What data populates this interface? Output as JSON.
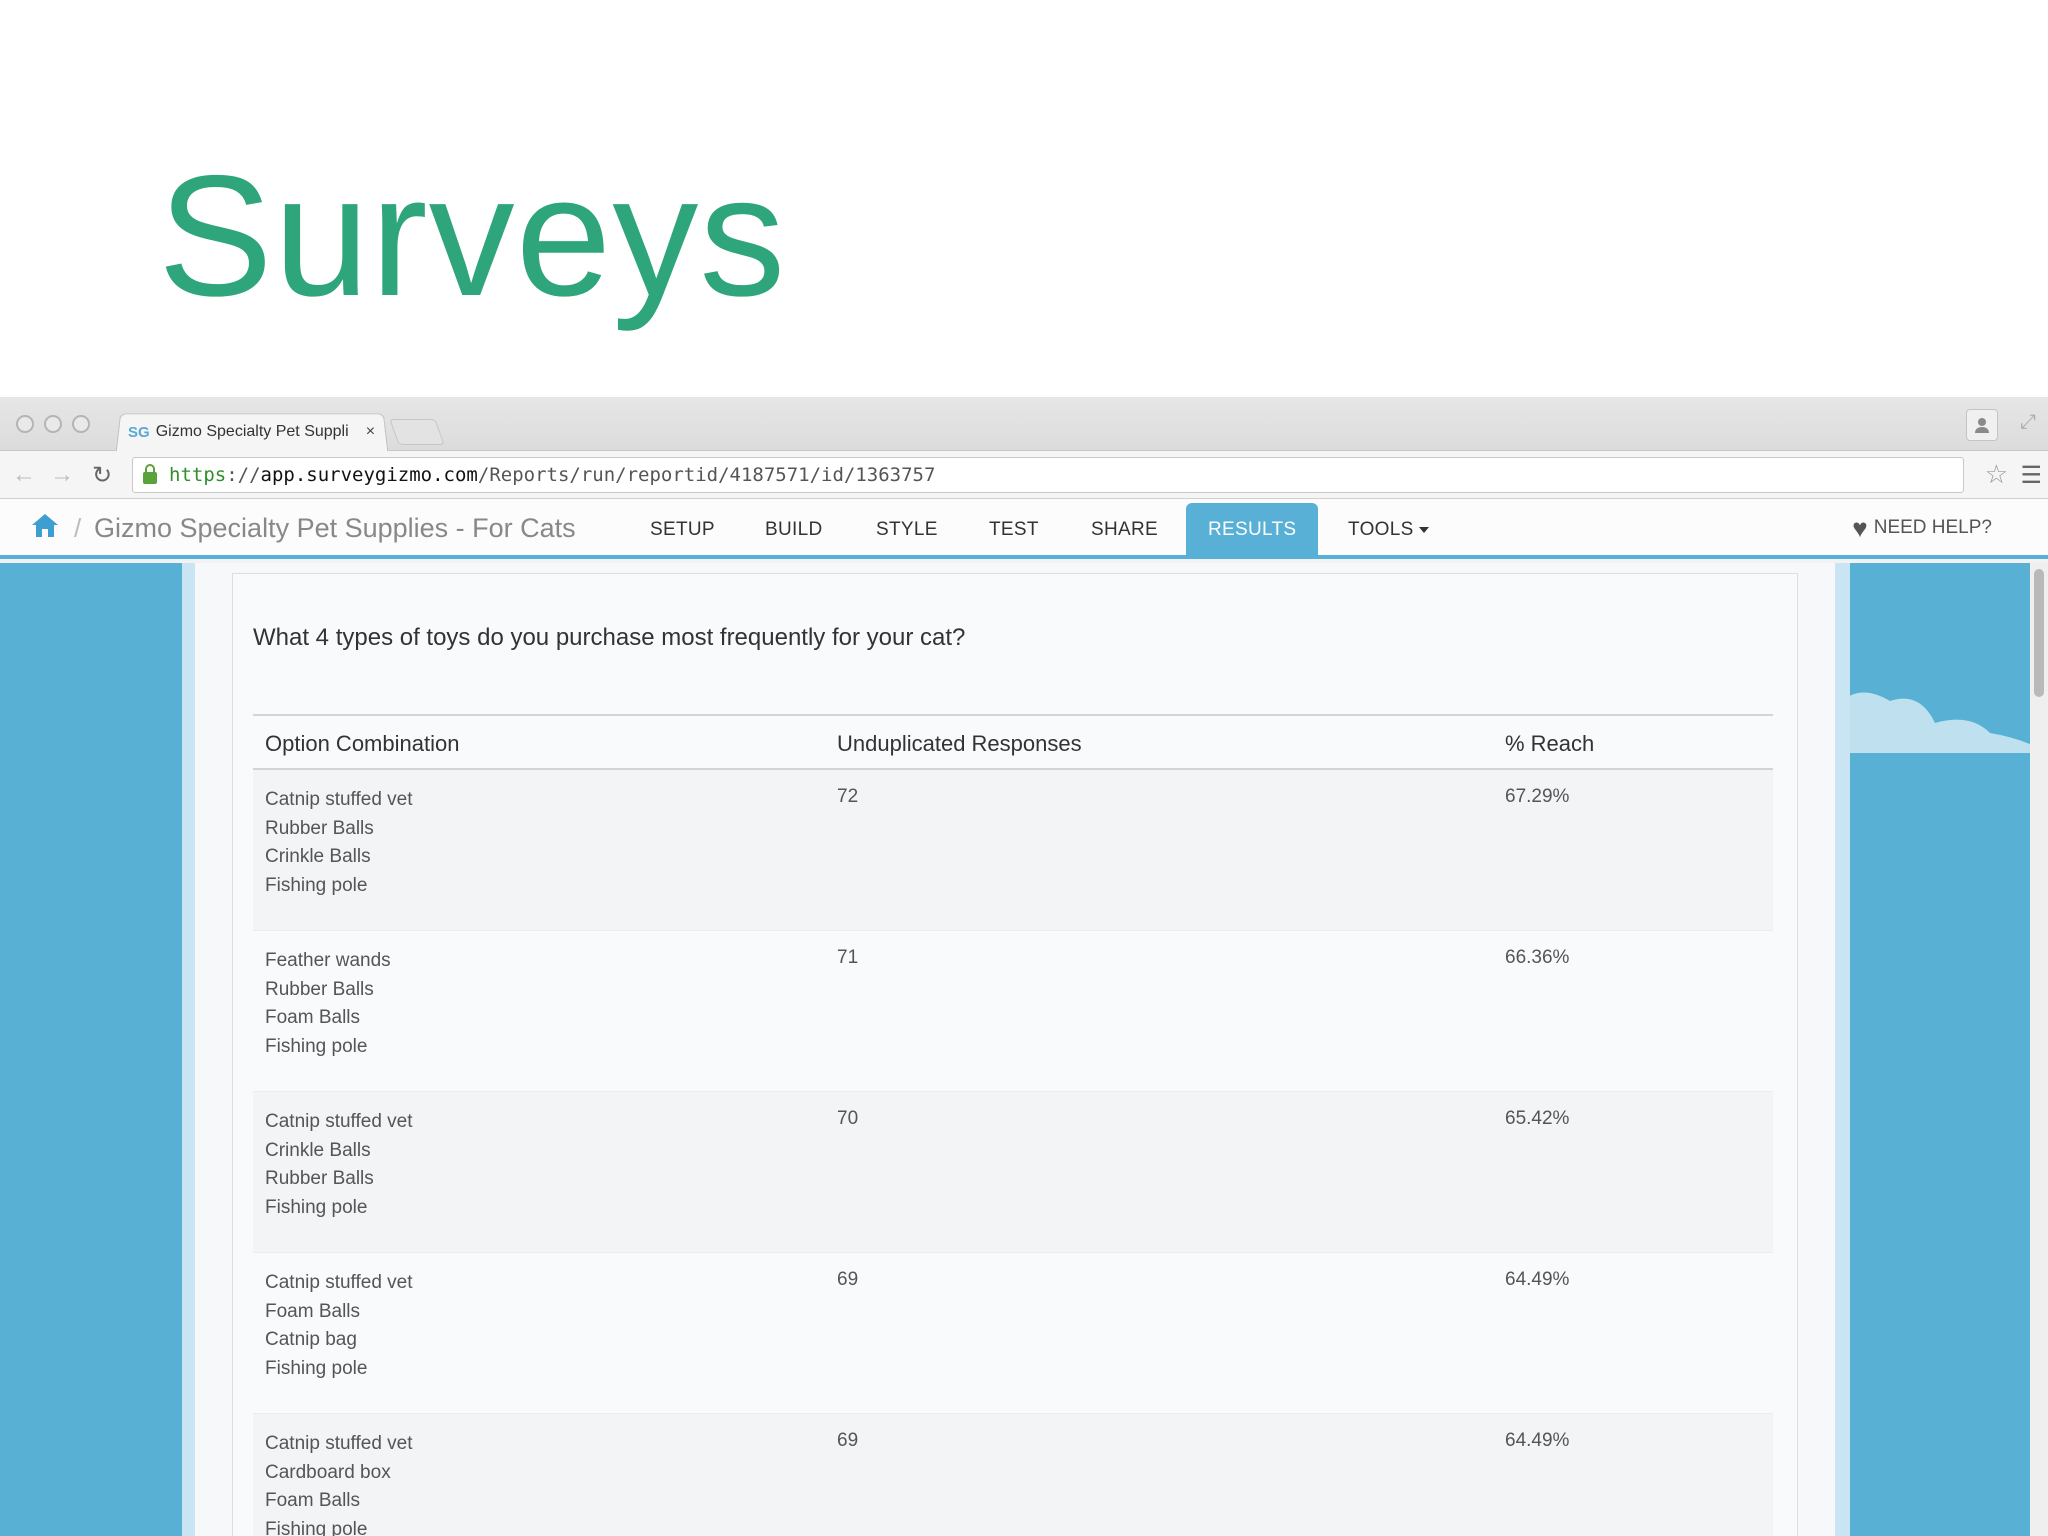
{
  "slide": {
    "title": "Surveys"
  },
  "browser": {
    "tab_title": "Gizmo Specialty Pet Suppli",
    "tab_favicon": "SG",
    "tab_close": "×",
    "url_scheme": "https",
    "url_sep": "://",
    "url_host": "app.surveygizmo.com",
    "url_path": "/Reports/run/reportid/4187571/id/1363757",
    "icons": [
      "back-arrow",
      "forward-arrow",
      "reload",
      "lock",
      "star",
      "hamburger-menu",
      "profile",
      "resize"
    ]
  },
  "app": {
    "survey_name": "Gizmo Specialty Pet Supplies - For Cats",
    "breadcrumb_sep": "/",
    "nav": {
      "setup": "SETUP",
      "build": "BUILD",
      "style": "STYLE",
      "test": "TEST",
      "share": "SHARE",
      "results": "RESULTS",
      "tools": "TOOLS"
    },
    "active_tab": "RESULTS",
    "help": "NEED HELP?",
    "accent_color": "#59b0d6"
  },
  "report": {
    "question": "What 4 types of toys do you purchase most frequently for your cat?",
    "columns": [
      "Option Combination",
      "Unduplicated Responses",
      "% Reach"
    ],
    "rows": [
      {
        "options": [
          "Catnip stuffed vet",
          "Rubber Balls",
          "Crinkle Balls",
          "Fishing pole"
        ],
        "responses": "72",
        "reach": "67.29%"
      },
      {
        "options": [
          "Feather wands",
          "Rubber Balls",
          "Foam Balls",
          "Fishing pole"
        ],
        "responses": "71",
        "reach": "66.36%"
      },
      {
        "options": [
          "Catnip stuffed vet",
          "Crinkle Balls",
          "Rubber Balls",
          "Fishing pole"
        ],
        "responses": "70",
        "reach": "65.42%"
      },
      {
        "options": [
          "Catnip stuffed vet",
          "Foam Balls",
          "Catnip bag",
          "Fishing pole"
        ],
        "responses": "69",
        "reach": "64.49%"
      },
      {
        "options": [
          "Catnip stuffed vet",
          "Cardboard box",
          "Foam Balls",
          "Fishing pole"
        ],
        "responses": "69",
        "reach": "64.49%"
      }
    ]
  }
}
